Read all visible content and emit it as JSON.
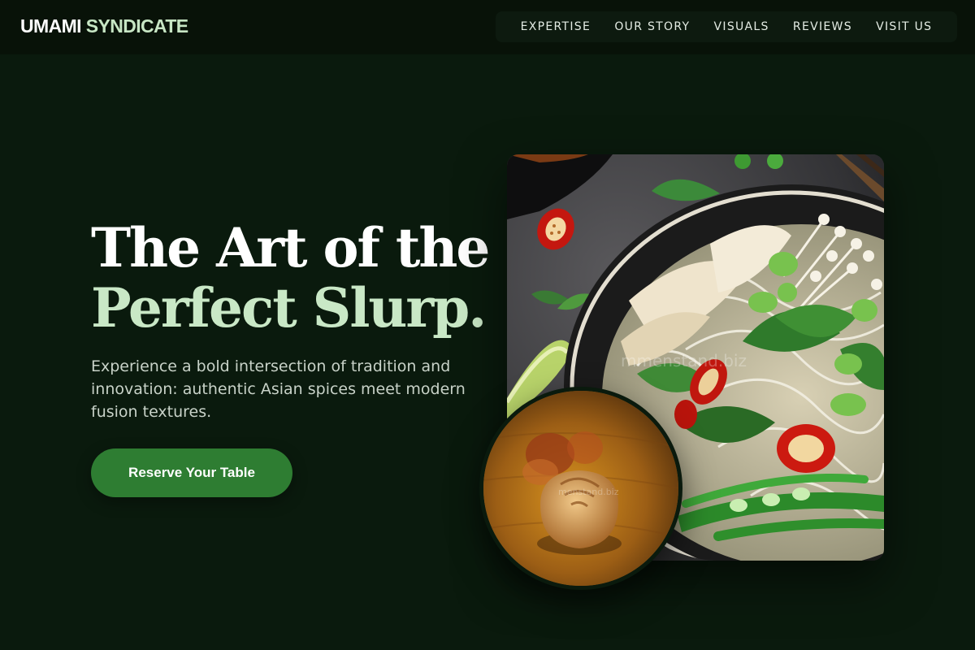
{
  "header": {
    "brand_primary": "UMAMI",
    "brand_accent": "SYNDICATE",
    "nav": [
      {
        "label": "EXPERTISE"
      },
      {
        "label": "OUR STORY"
      },
      {
        "label": "VISUALS"
      },
      {
        "label": "REVIEWS"
      },
      {
        "label": "VISIT US"
      }
    ]
  },
  "hero": {
    "title_line1": "The Art of the",
    "title_line2": "Perfect Slurp.",
    "subtitle": "Experience a bold intersection of tradition and innovation: authentic Asian spices meet modern fusion textures.",
    "cta_label": "Reserve Your Table"
  },
  "images": {
    "main_watermark": "mmenstand.biz",
    "small_watermark": "menstand.biz"
  },
  "colors": {
    "background": "#0a1a0d",
    "header": "#081208",
    "accent_green": "#2e7d32",
    "accent_mint": "#c9e8c6"
  }
}
